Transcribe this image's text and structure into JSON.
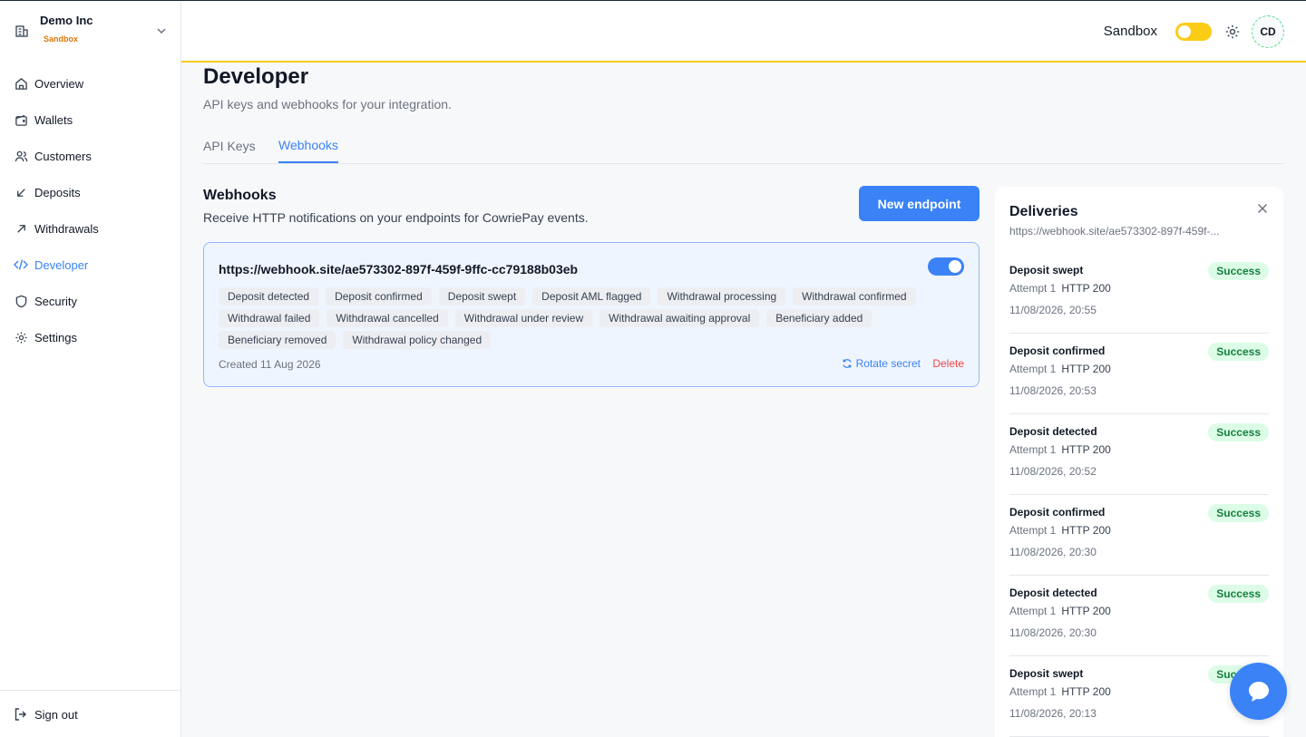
{
  "org": {
    "name": "Demo Inc",
    "badge": "Sandbox"
  },
  "nav": [
    {
      "label": "Overview",
      "icon": "home-icon"
    },
    {
      "label": "Wallets",
      "icon": "wallet-icon"
    },
    {
      "label": "Customers",
      "icon": "users-icon"
    },
    {
      "label": "Deposits",
      "icon": "arrow-down-left-icon"
    },
    {
      "label": "Withdrawals",
      "icon": "arrow-up-right-icon"
    },
    {
      "label": "Developer",
      "icon": "code-icon",
      "active": true
    },
    {
      "label": "Security",
      "icon": "shield-icon"
    },
    {
      "label": "Settings",
      "icon": "gear-icon"
    }
  ],
  "signout": "Sign out",
  "topbar": {
    "sandbox_label": "Sandbox",
    "avatar_initials": "CD"
  },
  "page": {
    "title": "Developer",
    "subtitle": "API keys and webhooks for your integration.",
    "tabs": [
      "API Keys",
      "Webhooks"
    ]
  },
  "webhooks": {
    "title": "Webhooks",
    "subtitle": "Receive HTTP notifications on your endpoints for CowriePay events.",
    "new_button": "New endpoint",
    "endpoint": {
      "url": "https://webhook.site/ae573302-897f-459f-9ffc-cc79188b03eb",
      "events": [
        "Deposit detected",
        "Deposit confirmed",
        "Deposit swept",
        "Deposit AML flagged",
        "Withdrawal processing",
        "Withdrawal confirmed",
        "Withdrawal failed",
        "Withdrawal cancelled",
        "Withdrawal under review",
        "Withdrawal awaiting approval",
        "Beneficiary added",
        "Beneficiary removed",
        "Withdrawal policy changed"
      ],
      "created": "Created 11 Aug 2026",
      "rotate_label": "Rotate secret",
      "delete_label": "Delete"
    }
  },
  "deliveries": {
    "title": "Deliveries",
    "url": "https://webhook.site/ae573302-897f-459f-...",
    "items": [
      {
        "event": "Deposit swept",
        "attempt": "Attempt 1",
        "http": "HTTP 200",
        "time": "11/08/2026, 20:55",
        "status": "Success"
      },
      {
        "event": "Deposit confirmed",
        "attempt": "Attempt 1",
        "http": "HTTP 200",
        "time": "11/08/2026, 20:53",
        "status": "Success"
      },
      {
        "event": "Deposit detected",
        "attempt": "Attempt 1",
        "http": "HTTP 200",
        "time": "11/08/2026, 20:52",
        "status": "Success"
      },
      {
        "event": "Deposit confirmed",
        "attempt": "Attempt 1",
        "http": "HTTP 200",
        "time": "11/08/2026, 20:30",
        "status": "Success"
      },
      {
        "event": "Deposit detected",
        "attempt": "Attempt 1",
        "http": "HTTP 200",
        "time": "11/08/2026, 20:30",
        "status": "Success"
      },
      {
        "event": "Deposit swept",
        "attempt": "Attempt 1",
        "http": "HTTP 200",
        "time": "11/08/2026, 20:13",
        "status": "Success"
      }
    ]
  },
  "colors": {
    "accent": "#3b82f6",
    "sandbox": "#facc15",
    "success_bg": "#dcfce7",
    "success_text": "#15803d",
    "danger": "#ef4444"
  }
}
